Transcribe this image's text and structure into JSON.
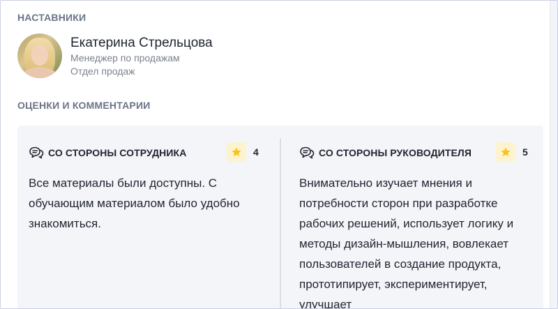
{
  "mentors": {
    "section_title": "НАСТАВНИКИ",
    "person": {
      "name": "Екатерина Стрельцова",
      "position": "Менеджер по продажам",
      "department": "Отдел продаж"
    }
  },
  "ratings": {
    "section_title": "ОЦЕНКИ И КОММЕНТАРИИ",
    "employee": {
      "title": "СО СТОРОНЫ СОТРУДНИКА",
      "score": "4",
      "comment": "Все материалы были доступны. С обучающим материалом было удобно знакомиться."
    },
    "manager": {
      "title": "СО СТОРОНЫ РУКОВОДИТЕЛЯ",
      "score": "5",
      "comment": "Внимательно изучает мнения и потребности сторон при разработке рабочих решений, использует логику и методы дизайн-мышления, вовлекает пользователей в создание продукта, прототипирует, экспериментирует, улучшает"
    }
  },
  "icons": {
    "comment": "chat-bubble-icon",
    "star": "star-icon"
  },
  "colors": {
    "star": "#f5c518",
    "star_badge_bg": "#fdf3cf",
    "section_title": "#6b7386",
    "card_bg": "#f4f5f8"
  }
}
